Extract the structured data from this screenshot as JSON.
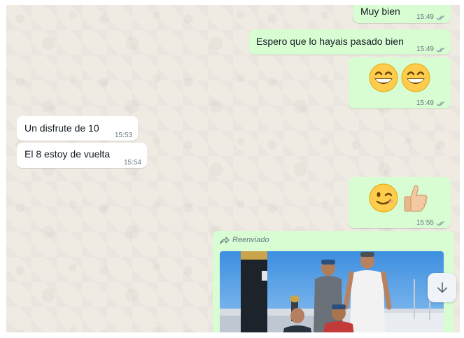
{
  "messages": [
    {
      "id": "m1",
      "direction": "outgoing",
      "text": "Muy bien",
      "time": "15:49",
      "status": "read"
    },
    {
      "id": "m2",
      "direction": "outgoing",
      "text": "Espero que lo hayais pasado bien",
      "time": "15:49",
      "status": "read"
    },
    {
      "id": "m3",
      "direction": "outgoing",
      "emojis": [
        "grinning-face-with-smiling-eyes",
        "grinning-face-with-smiling-eyes"
      ],
      "time": "15:49",
      "status": "read"
    },
    {
      "id": "m4",
      "direction": "incoming",
      "text": "Un disfrute de 10",
      "time": "15:53"
    },
    {
      "id": "m5",
      "direction": "incoming",
      "text": "El 8 estoy de vuelta",
      "time": "15:54"
    },
    {
      "id": "m6",
      "direction": "outgoing",
      "emojis": [
        "winking-face",
        "thumbs-up"
      ],
      "time": "15:55",
      "status": "read"
    },
    {
      "id": "m7",
      "direction": "outgoing",
      "forwarded_label": "Reenviado",
      "media": "photo"
    }
  ],
  "colors": {
    "outgoing_bubble": "#d9fdd3",
    "incoming_bubble": "#ffffff",
    "chat_background": "#efeae2",
    "read_ticks": "#8696a0"
  },
  "icons": {
    "read_status": "double-check-icon",
    "forwarded": "forward-arrow-icon",
    "scroll_down": "arrow-down-icon"
  }
}
